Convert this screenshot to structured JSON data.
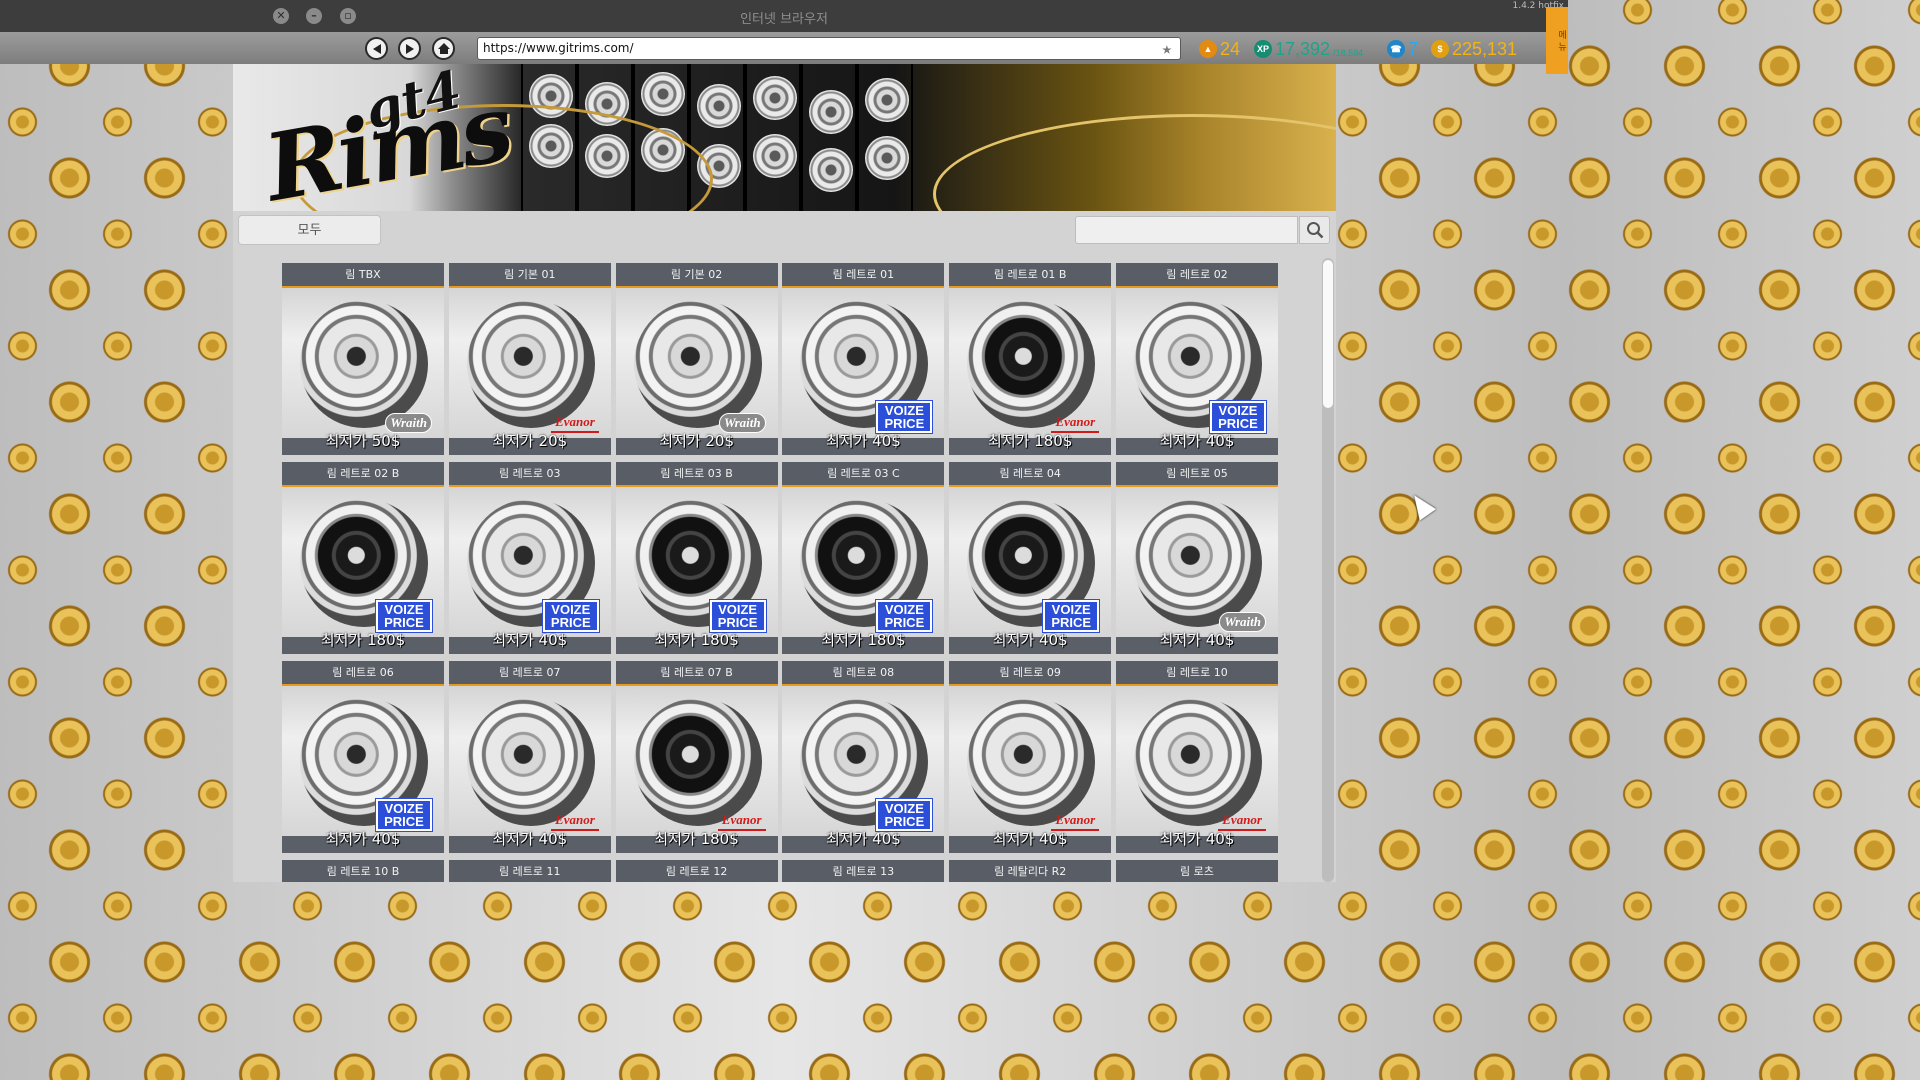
{
  "window": {
    "title": "인터넷 브라우저",
    "version": "1.4.2 hotfix",
    "side_tab": "메 뉴"
  },
  "browser": {
    "url": "https://www.gitrims.com/"
  },
  "stats": {
    "level": "24",
    "xp": "17,392",
    "xp_max": "/18,594",
    "phone": "7",
    "money": "225,131"
  },
  "site": {
    "logo_top": "gt4",
    "logo_main": "Rims",
    "filter_label": "모두",
    "search_placeholder": ""
  },
  "products": [
    {
      "name": "림 TBX",
      "price": "최저가 50$",
      "brand": "Wraith",
      "brand_type": "wraith",
      "style": "light"
    },
    {
      "name": "림 기본 01",
      "price": "최저가 20$",
      "brand": "Evanor",
      "brand_type": "evanor",
      "style": "light"
    },
    {
      "name": "림 기본 02",
      "price": "최저가 20$",
      "brand": "Wraith",
      "brand_type": "wraith",
      "style": "light"
    },
    {
      "name": "림 레트로 01",
      "price": "최저가 40$",
      "brand": "VOIZE PRICE",
      "brand_type": "voize",
      "style": "light"
    },
    {
      "name": "림 레트로 01 B",
      "price": "최저가 180$",
      "brand": "Evanor",
      "brand_type": "evanor",
      "style": "dark"
    },
    {
      "name": "림 레트로 02",
      "price": "최저가 40$",
      "brand": "VOIZE PRICE",
      "brand_type": "voize",
      "style": "light"
    },
    {
      "name": "림 레트로 02 B",
      "price": "최저가 180$",
      "brand": "VOIZE PRICE",
      "brand_type": "voize",
      "style": "dark"
    },
    {
      "name": "림 레트로 03",
      "price": "최저가 40$",
      "brand": "VOIZE PRICE",
      "brand_type": "voize",
      "style": "light"
    },
    {
      "name": "림 레트로 03 B",
      "price": "최저가 180$",
      "brand": "VOIZE PRICE",
      "brand_type": "voize",
      "style": "dark"
    },
    {
      "name": "림 레트로 03 C",
      "price": "최저가 180$",
      "brand": "VOIZE PRICE",
      "brand_type": "voize",
      "style": "dark"
    },
    {
      "name": "림 레트로 04",
      "price": "최저가 40$",
      "brand": "VOIZE PRICE",
      "brand_type": "voize",
      "style": "dark"
    },
    {
      "name": "림 레트로 05",
      "price": "최저가 40$",
      "brand": "Wraith",
      "brand_type": "wraith",
      "style": "light"
    },
    {
      "name": "림 레트로 06",
      "price": "최저가 40$",
      "brand": "VOIZE PRICE",
      "brand_type": "voize",
      "style": "light"
    },
    {
      "name": "림 레트로 07",
      "price": "최저가 40$",
      "brand": "Evanor",
      "brand_type": "evanor",
      "style": "light"
    },
    {
      "name": "림 레트로 07 B",
      "price": "최저가 180$",
      "brand": "Evanor",
      "brand_type": "evanor",
      "style": "dark"
    },
    {
      "name": "림 레트로 08",
      "price": "최저가 40$",
      "brand": "VOIZE PRICE",
      "brand_type": "voize",
      "style": "light"
    },
    {
      "name": "림 레트로 09",
      "price": "최저가 40$",
      "brand": "Evanor",
      "brand_type": "evanor",
      "style": "light"
    },
    {
      "name": "림 레트로 10",
      "price": "최저가 40$",
      "brand": "Evanor",
      "brand_type": "evanor",
      "style": "light"
    },
    {
      "name": "림 레트로 10 B",
      "price": "",
      "brand": "",
      "brand_type": "",
      "style": "dark"
    },
    {
      "name": "림 레트로 11",
      "price": "",
      "brand": "",
      "brand_type": "",
      "style": "light"
    },
    {
      "name": "림 레트로 12",
      "price": "",
      "brand": "",
      "brand_type": "",
      "style": "light"
    },
    {
      "name": "림 레트로 13",
      "price": "",
      "brand": "",
      "brand_type": "",
      "style": "light"
    },
    {
      "name": "림 레탈리다 R2",
      "price": "",
      "brand": "",
      "brand_type": "",
      "style": "light"
    },
    {
      "name": "림 로츠",
      "price": "",
      "brand": "",
      "brand_type": "",
      "style": "light"
    }
  ],
  "colors": {
    "accent": "#e89a1a",
    "card_header": "#585d66",
    "voize_blue": "#2b4fd8",
    "evanor_red": "#d11b1b"
  }
}
